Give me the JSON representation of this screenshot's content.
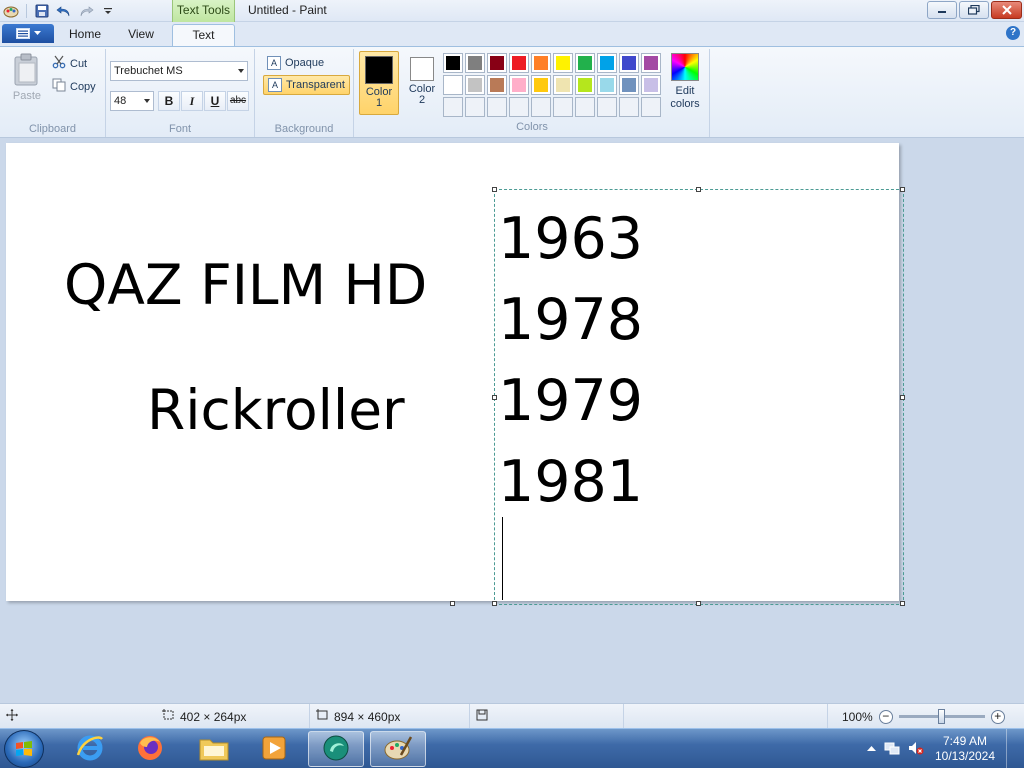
{
  "window": {
    "title": "Untitled - Paint",
    "context_tab": "Text Tools"
  },
  "tabs": [
    {
      "label": "Home"
    },
    {
      "label": "View"
    },
    {
      "label": "Text"
    }
  ],
  "clipboard": {
    "paste": "Paste",
    "cut": "Cut",
    "copy": "Copy",
    "group_label": "Clipboard"
  },
  "font": {
    "family": "Trebuchet MS",
    "size": "48",
    "bold": "B",
    "italic": "I",
    "underline": "U",
    "strike": "abc",
    "group_label": "Font"
  },
  "background": {
    "opaque": "Opaque",
    "transparent": "Transparent",
    "group_label": "Background"
  },
  "colors": {
    "color1_label": "Color",
    "color1_num": "1",
    "color2_label": "Color",
    "color2_num": "2",
    "color1": "#000000",
    "color2": "#ffffff",
    "edit_colors_line1": "Edit",
    "edit_colors_line2": "colors",
    "group_label": "Colors",
    "palette_row1": [
      "#000000",
      "#7f7f7f",
      "#880015",
      "#ed1c24",
      "#ff7f27",
      "#fff200",
      "#22b14c",
      "#00a2e8",
      "#3f48cc",
      "#a349a4"
    ],
    "palette_row2": [
      "#ffffff",
      "#c3c3c3",
      "#b97a57",
      "#ffaec9",
      "#ffc90e",
      "#efe4b0",
      "#b5e61d",
      "#99d9ea",
      "#7092be",
      "#c8bfe7"
    ]
  },
  "canvas": {
    "line1": "QAZ FILM HD",
    "line2": "Rickroller",
    "years": [
      "1963",
      "1978",
      "1979",
      "1981"
    ]
  },
  "status": {
    "selection_size": "402 × 264px",
    "canvas_size": "894 × 460px",
    "zoom": "100%",
    "zoom_level_percent": 100
  },
  "taskbar": {
    "time": "7:49 AM",
    "date": "10/13/2024"
  },
  "icons": [
    "save-icon",
    "undo-icon",
    "redo-icon",
    "paste-icon",
    "cut-icon",
    "copy-icon",
    "help-icon"
  ]
}
